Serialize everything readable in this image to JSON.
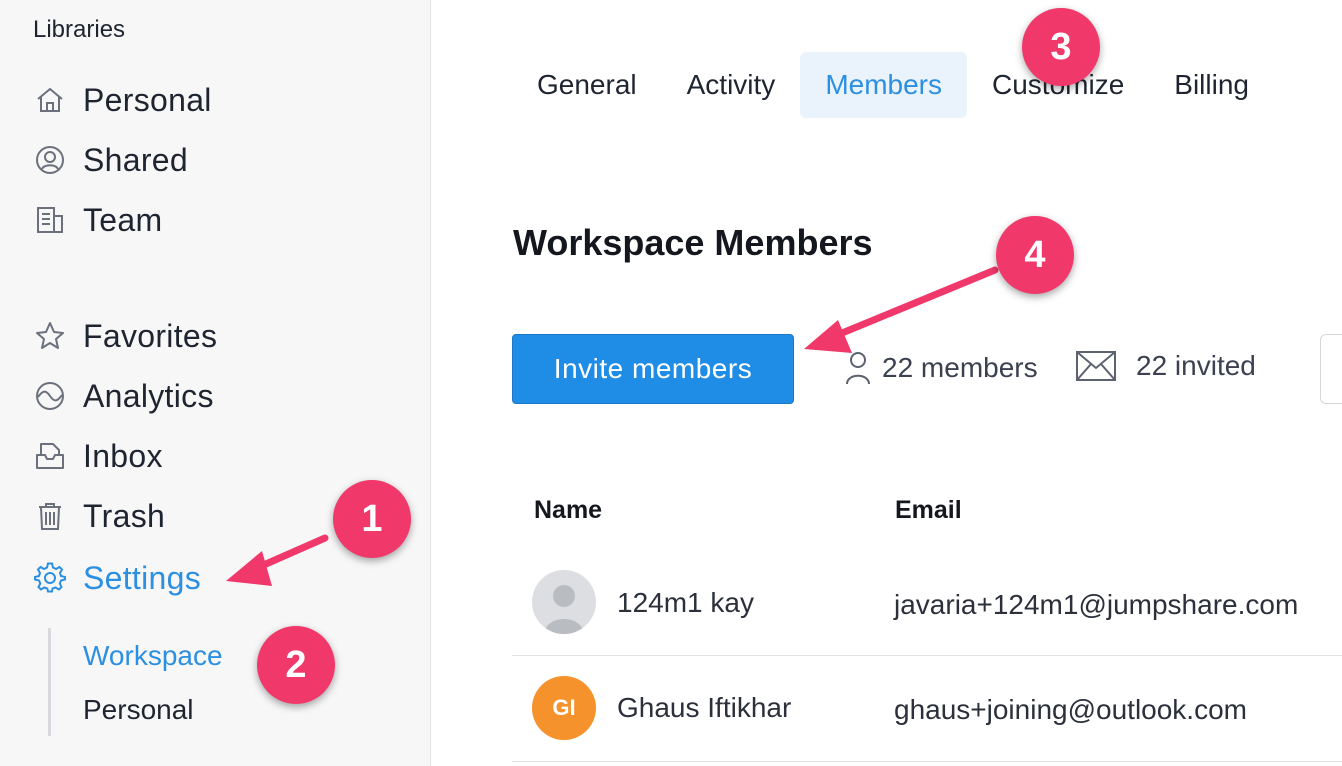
{
  "sidebar": {
    "heading": "Libraries",
    "items": [
      {
        "label": "Personal",
        "icon": "home-icon"
      },
      {
        "label": "Shared",
        "icon": "shared-user-icon"
      },
      {
        "label": "Team",
        "icon": "team-building-icon"
      },
      {
        "label": "Favorites",
        "icon": "star-icon"
      },
      {
        "label": "Analytics",
        "icon": "analytics-wave-icon"
      },
      {
        "label": "Inbox",
        "icon": "inbox-icon"
      },
      {
        "label": "Trash",
        "icon": "trash-icon"
      },
      {
        "label": "Settings",
        "icon": "gear-icon",
        "active": true
      }
    ],
    "subitems": [
      {
        "label": "Workspace",
        "active": true
      },
      {
        "label": "Personal"
      }
    ]
  },
  "tabs": [
    {
      "label": "General"
    },
    {
      "label": "Activity"
    },
    {
      "label": "Members",
      "active": true
    },
    {
      "label": "Customize"
    },
    {
      "label": "Billing"
    }
  ],
  "main": {
    "title": "Workspace Members",
    "invite_label": "Invite members",
    "members_count": "22 members",
    "invited_count": "22 invited"
  },
  "table": {
    "headers": {
      "name": "Name",
      "email": "Email"
    },
    "rows": [
      {
        "name": "124m1 kay",
        "email": "javaria+124m1@jumpshare.com",
        "avatar": "default-avatar-icon"
      },
      {
        "name": "Ghaus Iftikhar",
        "email": "ghaus+joining@outlook.com",
        "initials": "GI"
      }
    ]
  },
  "annotations": {
    "badge1": "1",
    "badge2": "2",
    "badge3": "3",
    "badge4": "4"
  },
  "colors": {
    "accent": "#2d8fe0",
    "button": "#1f8ce6",
    "badge": "#f0386b",
    "avatar_orange": "#f5922b"
  }
}
